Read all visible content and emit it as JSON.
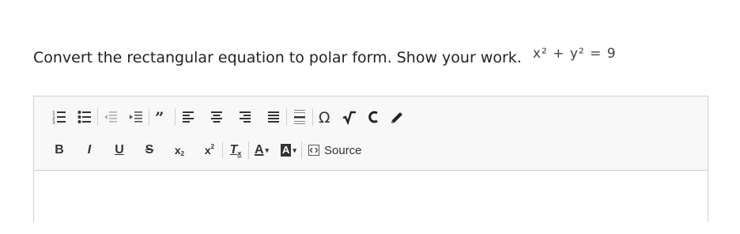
{
  "question": {
    "text": "Convert the rectangular equation to polar form. Show your work.",
    "equation": "x² + y² = 9"
  },
  "toolbar": {
    "row1": [
      {
        "name": "numbered-list-icon",
        "title": "Insert/Remove Numbered List"
      },
      {
        "name": "bulleted-list-icon",
        "title": "Insert/Remove Bulleted List"
      },
      {
        "name": "decrease-indent-icon",
        "title": "Decrease Indent"
      },
      {
        "name": "increase-indent-icon",
        "title": "Increase Indent"
      },
      {
        "name": "blockquote-icon",
        "title": "Block Quote"
      },
      {
        "name": "align-left-icon",
        "title": "Align Left"
      },
      {
        "name": "align-center-icon",
        "title": "Center"
      },
      {
        "name": "align-right-icon",
        "title": "Align Right"
      },
      {
        "name": "justify-icon",
        "title": "Justify"
      },
      {
        "name": "horizontal-line-icon",
        "title": "Insert Horizontal Line"
      },
      {
        "name": "omega-icon",
        "title": "Insert Special Character"
      },
      {
        "name": "square-root-icon",
        "title": "Math"
      },
      {
        "name": "chemistry-icon",
        "title": "Chemistry"
      },
      {
        "name": "pencil-icon",
        "title": "Draw"
      }
    ],
    "row2": {
      "bold": "B",
      "italic": "I",
      "underline": "U",
      "strike": "S",
      "subscript": "x",
      "superscript": "x",
      "remove_format": "T",
      "text_color": "A",
      "bg_color": "A",
      "source_label": "Source"
    }
  },
  "colors": {
    "toolbar_bg": "#f8f8f8",
    "border": "#d1d1d1",
    "icon": "#333333",
    "disabled_icon": "#b0b0b0"
  }
}
